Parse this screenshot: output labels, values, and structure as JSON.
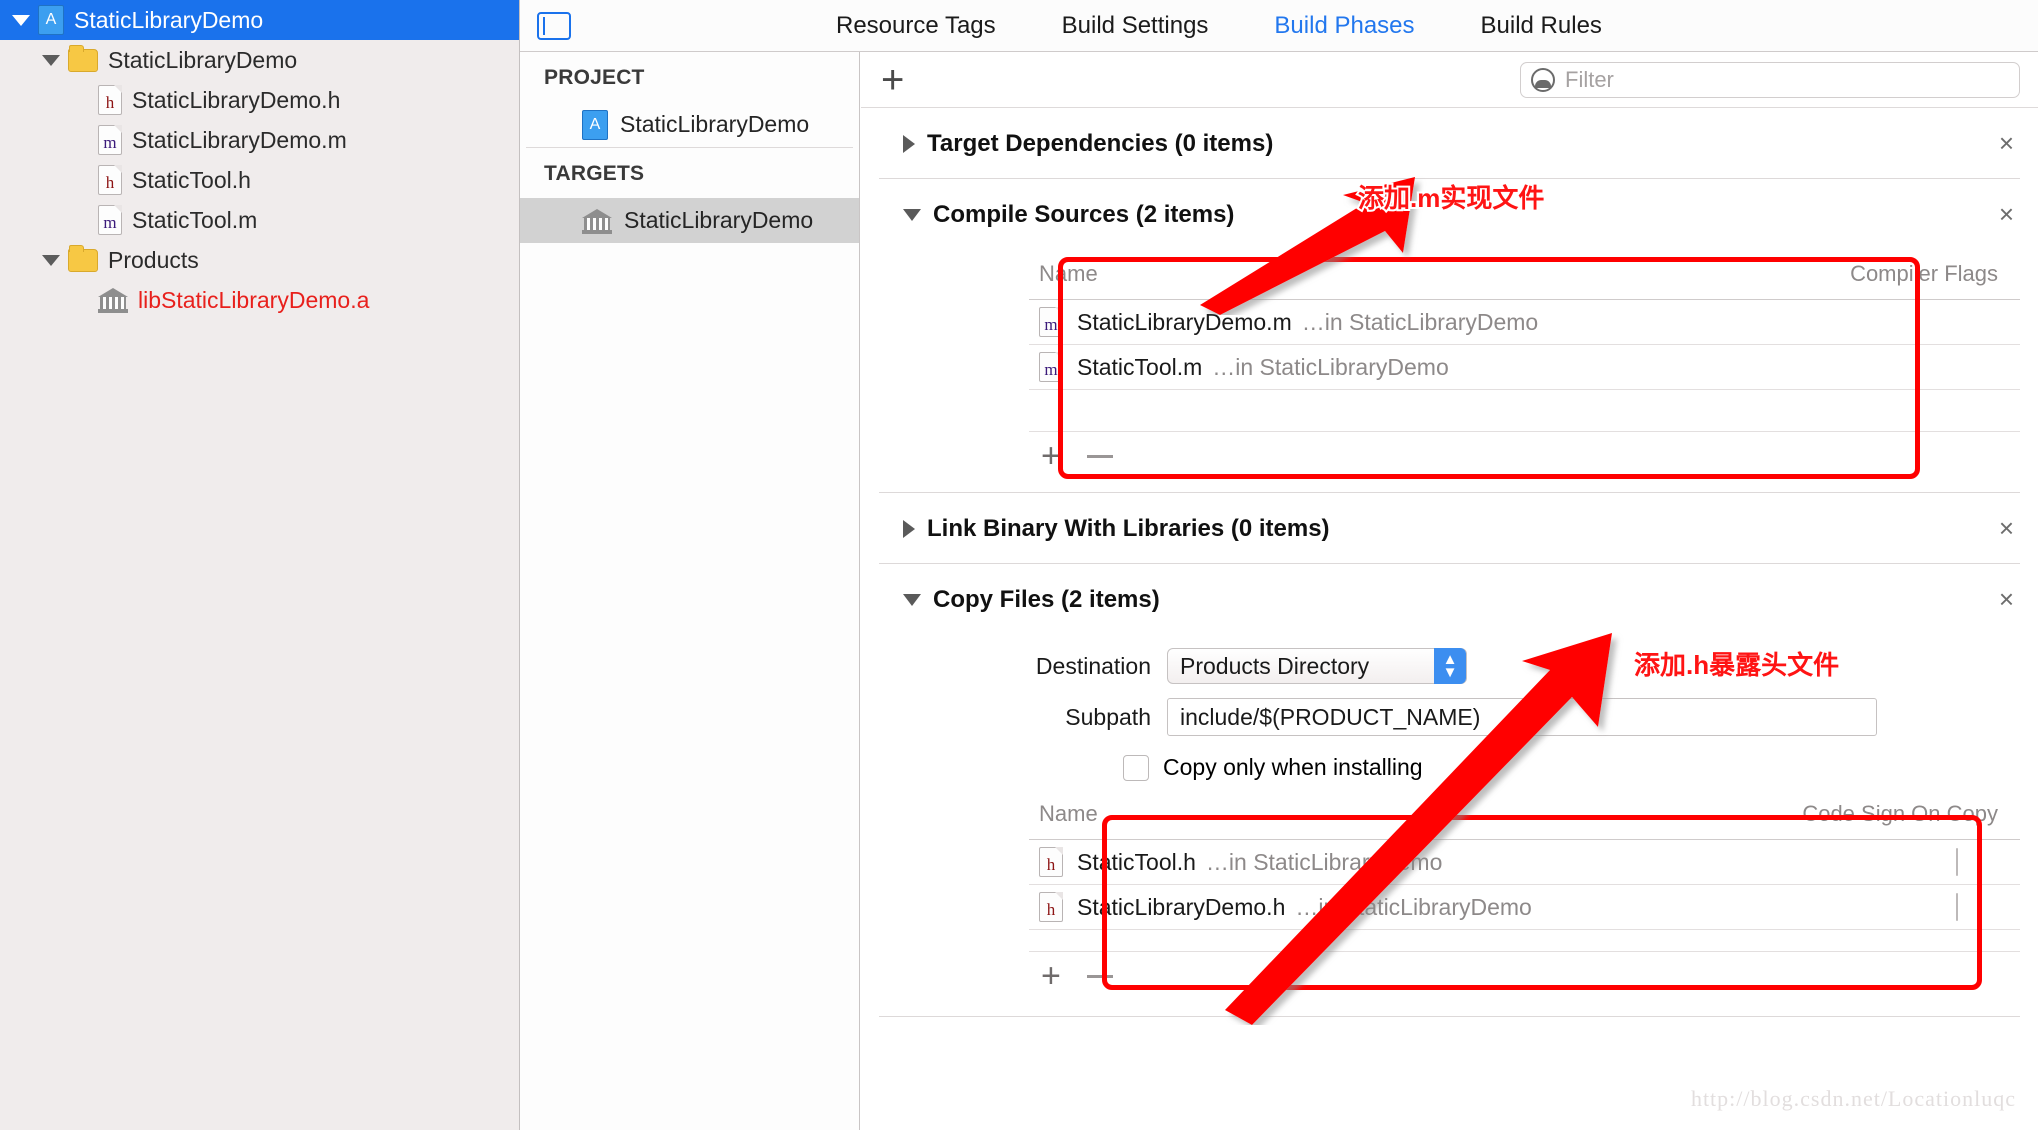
{
  "navigator": {
    "items": [
      {
        "label": "StaticLibraryDemo",
        "icon": "xcode-project-icon",
        "depth": 0,
        "disclosure": "down",
        "selected": true
      },
      {
        "label": "StaticLibraryDemo",
        "icon": "folder-icon",
        "depth": 1,
        "disclosure": "down",
        "selected": false
      },
      {
        "label": "StaticLibraryDemo.h",
        "icon": "header-file-icon",
        "depth": 2,
        "disclosure": "none",
        "selected": false
      },
      {
        "label": "StaticLibraryDemo.m",
        "icon": "implementation-file-icon",
        "depth": 2,
        "disclosure": "none",
        "selected": false
      },
      {
        "label": "StaticTool.h",
        "icon": "header-file-icon",
        "depth": 2,
        "disclosure": "none",
        "selected": false
      },
      {
        "label": "StaticTool.m",
        "icon": "implementation-file-icon",
        "depth": 2,
        "disclosure": "none",
        "selected": false
      },
      {
        "label": "Products",
        "icon": "folder-icon",
        "depth": 1,
        "disclosure": "down",
        "selected": false
      },
      {
        "label": "libStaticLibraryDemo.a",
        "icon": "static-library-icon",
        "depth": 2,
        "disclosure": "none",
        "selected": false,
        "red": true
      }
    ]
  },
  "tabbar": {
    "pane_toggle_icon": "navigator-toggle-icon",
    "tabs": [
      {
        "label": "Resource Tags",
        "active": false
      },
      {
        "label": "Build Settings",
        "active": false
      },
      {
        "label": "Build Phases",
        "active": true
      },
      {
        "label": "Build Rules",
        "active": false
      }
    ]
  },
  "projlist": {
    "project_header": "PROJECT",
    "project_item": "StaticLibraryDemo",
    "targets_header": "TARGETS",
    "target_item": "StaticLibraryDemo"
  },
  "toolbar": {
    "add_phase_label": "+",
    "filter_placeholder": "Filter",
    "filter_value": "",
    "filter_icon": "filter-icon"
  },
  "phases": {
    "target_dependencies": {
      "title": "Target Dependencies (0 items)",
      "expanded": false,
      "close_label": "×"
    },
    "compile_sources": {
      "title": "Compile Sources (2 items)",
      "expanded": true,
      "close_label": "×",
      "columns": [
        "Name",
        "Compiler Flags"
      ],
      "rows": [
        {
          "icon": "implementation-file-icon",
          "name": "StaticLibraryDemo.m",
          "location": "…in StaticLibraryDemo"
        },
        {
          "icon": "implementation-file-icon",
          "name": "StaticTool.m",
          "location": "…in StaticLibraryDemo"
        }
      ],
      "add_label": "+",
      "remove_label": "−"
    },
    "link_binary": {
      "title": "Link Binary With Libraries (0 items)",
      "expanded": false,
      "close_label": "×"
    },
    "copy_files": {
      "title": "Copy Files (2 items)",
      "expanded": true,
      "close_label": "×",
      "destination_label": "Destination",
      "destination_value": "Products Directory",
      "subpath_label": "Subpath",
      "subpath_value": "include/$(PRODUCT_NAME)",
      "copy_only_label": "Copy only when installing",
      "copy_only_checked": false,
      "columns": [
        "Name",
        "Code Sign On Copy"
      ],
      "rows": [
        {
          "icon": "header-file-icon",
          "name": "StaticTool.h",
          "location": "…in StaticLibraryDemo",
          "code_sign": false
        },
        {
          "icon": "header-file-icon",
          "name": "StaticLibraryDemo.h",
          "location": "…in StaticLibraryDemo",
          "code_sign": false
        }
      ],
      "add_label": "+",
      "remove_label": "−"
    }
  },
  "annotations": [
    {
      "text": "添加.m实现文件",
      "color": "#ff1414"
    },
    {
      "text": "添加.h暴露头文件",
      "color": "#ff1414"
    }
  ],
  "watermark": "http://blog.csdn.net/Locationluqc",
  "colors": {
    "accent": "#1a72ec",
    "annotation": "#ff0000",
    "selected_row": "#1a72ec",
    "target_selected": "#d2d2d2",
    "library_red": "#e8201c"
  }
}
